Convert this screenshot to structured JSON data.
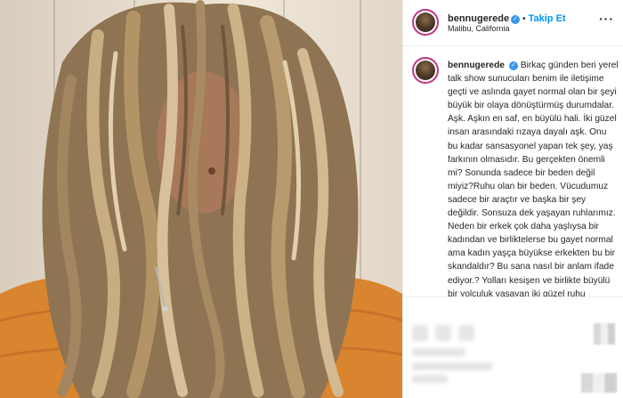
{
  "post": {
    "username": "bennugerede",
    "verified_glyph": "✓",
    "follow_label": "Takip Et",
    "separator": "•",
    "location": "Malibu, California",
    "more_label": "···",
    "caption": "Birkaç günden beri yerel talk show sunucuları benim ile iletişime geçti ve aslında gayet normal olan bir şeyi büyük bir olaya dönüştürmüş durumdalar. Aşk. Aşkın en saf, en büyülü hali. İki güzel insan arasındaki rızaya dayalı aşk. Onu bu kadar sansasyonel yapan tek şey, yaş farkının olmasıdır. Bu gerçekten önemli mi? Sonunda sadece bir beden değil miyiz?Ruhu olan bir beden. Vücudumuz sadece bir araçtır ve başka bir şey değildir. Sonsuza dek yaşayan ruhlarımız. Neden bir erkek çok daha yaşlıysa bir kadından ve birliktelerse bu gayet normal ama kadın yaşça büyükse erkekten bu bir skandaldır? Bu sana nasıl bir anlam ifade ediyor.? Yolları kesişen ve birlikte büyülü bir yolculuk yaşayan iki güzel ruhu"
  },
  "icons": {
    "avatar": "profile-avatar",
    "verified": "verified-badge-icon",
    "more": "more-options-icon",
    "like": "heart-icon",
    "comment": "comment-icon",
    "share": "share-icon",
    "save": "bookmark-icon"
  },
  "colors": {
    "link_blue": "#0095f6",
    "verified_blue": "#3897f0",
    "text": "#262626",
    "border": "#efefef",
    "sweater_orange": "#d9852f"
  }
}
